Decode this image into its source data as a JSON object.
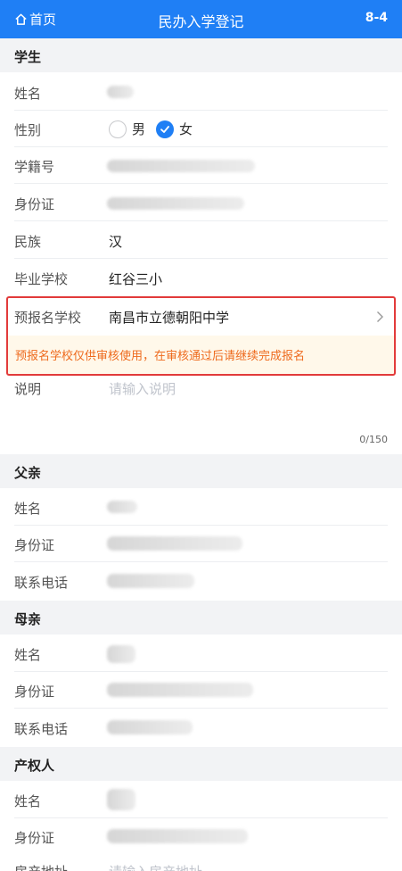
{
  "header": {
    "home_label": "首页",
    "title": "民办入学登记",
    "code": "8-4",
    "bg_color": "#1f7ff5"
  },
  "student": {
    "section_title": "学生",
    "name_label": "姓名",
    "gender_label": "性别",
    "gender_options": [
      "男",
      "女"
    ],
    "gender_selected": "女",
    "student_id_label": "学籍号",
    "id_card_label": "身份证",
    "ethnicity_label": "民族",
    "ethnicity_value": "汉",
    "grad_school_label": "毕业学校",
    "grad_school_value": "红谷三小",
    "pre_school_label": "预报名学校",
    "pre_school_value": "南昌市立德朝阳中学",
    "pre_school_notice": "预报名学校仅供审核使用，在审核通过后请继续完成报名",
    "desc_label": "说明",
    "desc_placeholder": "请输入说明",
    "desc_counter": "0/150"
  },
  "father": {
    "section_title": "父亲",
    "name_label": "姓名",
    "id_card_label": "身份证",
    "phone_label": "联系电话"
  },
  "mother": {
    "section_title": "母亲",
    "name_label": "姓名",
    "id_card_label": "身份证",
    "phone_label": "联系电话"
  },
  "owner": {
    "section_title": "产权人",
    "name_label": "姓名",
    "id_card_label": "身份证",
    "address_label": "房产地址",
    "address_placeholder": "请输入房产地址"
  },
  "colors": {
    "accent": "#1f7ff5",
    "highlight_border": "#e23b3b",
    "notice_text": "#ee6a1d",
    "notice_bg": "#fff8ea"
  }
}
